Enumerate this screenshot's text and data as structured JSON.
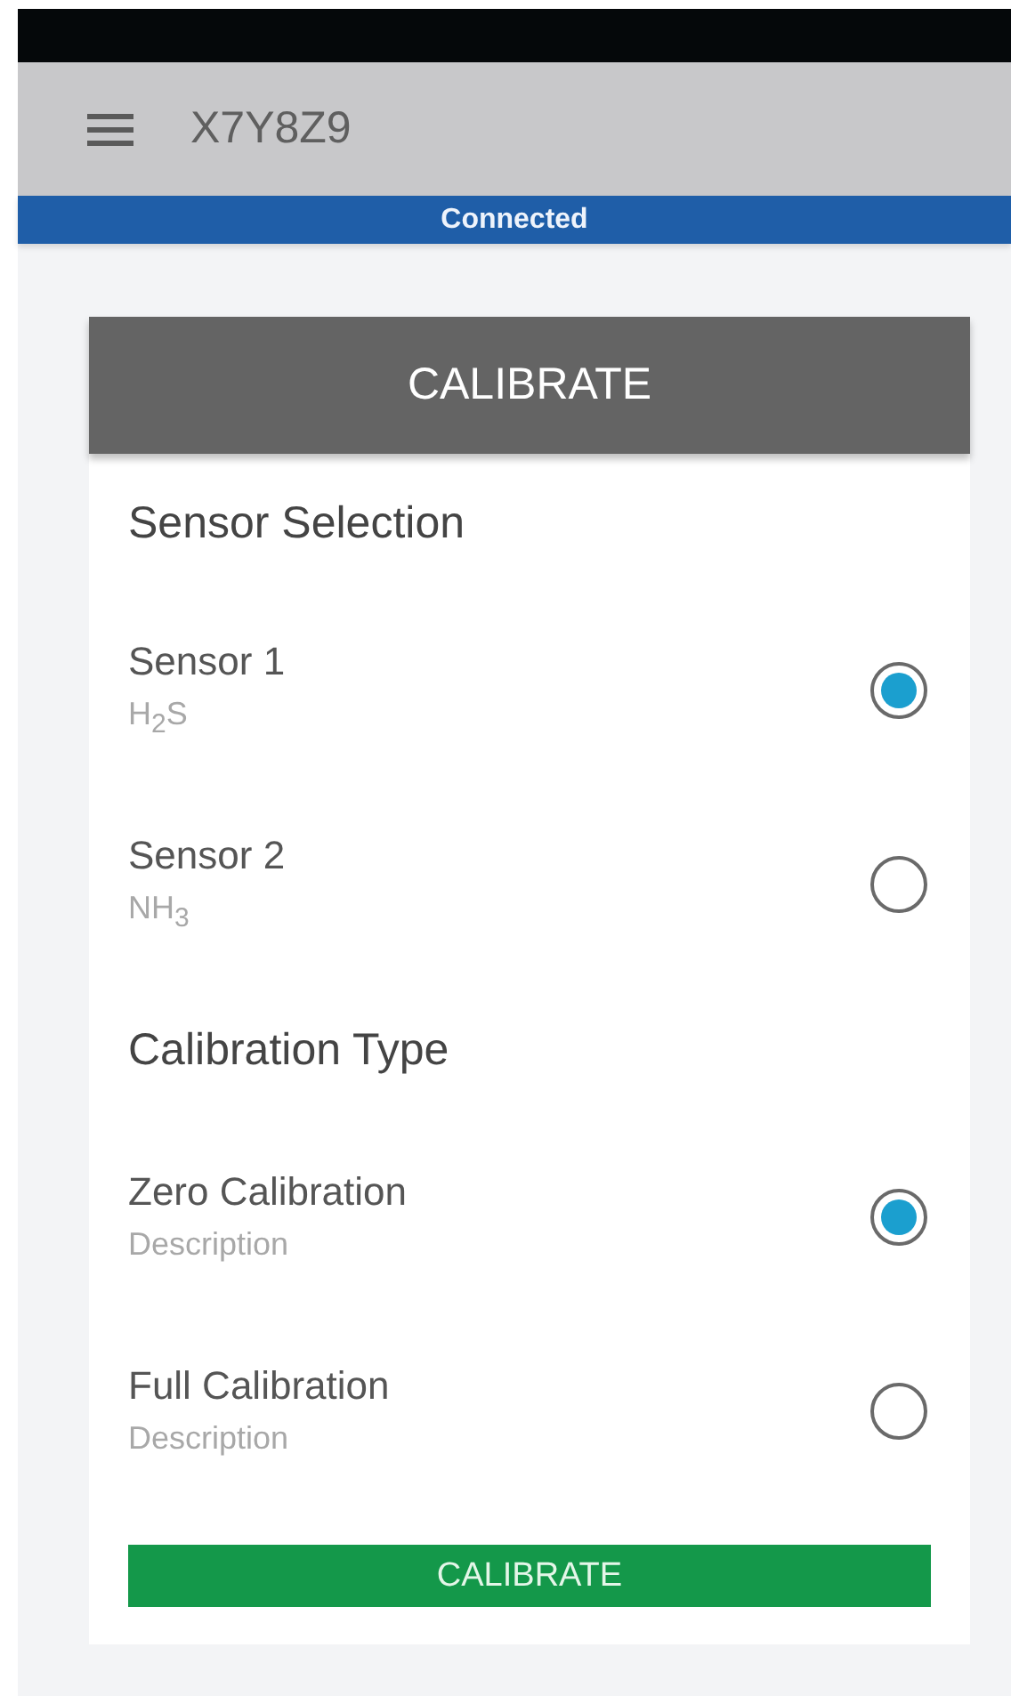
{
  "app_bar": {
    "title": "X7Y8Z9"
  },
  "connection": {
    "status": "Connected"
  },
  "card": {
    "title": "CALIBRATE",
    "sections": [
      {
        "title": "Sensor Selection",
        "options": [
          {
            "label": "Sensor 1",
            "description": "H$_{2}$S",
            "selected": true
          },
          {
            "label": "Sensor 2",
            "description": "NH$_{3}$",
            "selected": false
          }
        ]
      },
      {
        "title": "Calibration Type",
        "options": [
          {
            "label": "Zero Calibration",
            "description": "Description",
            "selected": true
          },
          {
            "label": "Full Calibration",
            "description": "Description",
            "selected": false
          }
        ]
      }
    ],
    "button": "CALIBRATE"
  }
}
